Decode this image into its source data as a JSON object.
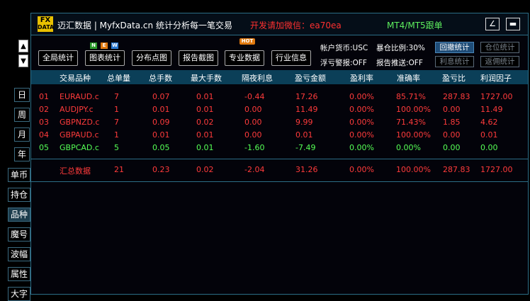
{
  "titlebar": {
    "logo_top": "FX",
    "logo_bottom": "DATA",
    "app_title": "迈汇数据 | MyfxData.cn   统计分析每一笔交易",
    "contact": "开发请加微信：ea70ea",
    "mt_label": "MT4/MT5跟单",
    "minimize_glyph": "∠",
    "restore_glyph": "▬"
  },
  "nav": {
    "up_glyph": "▲",
    "down_glyph": "▼"
  },
  "period_buttons": [
    "日",
    "周",
    "月",
    "年"
  ],
  "category_buttons": [
    "单币",
    "持仓",
    "品种",
    "魔号",
    "波幅",
    "属性",
    "大字"
  ],
  "active_category": "品种",
  "toolbar": {
    "buttons": [
      "全局统计",
      "图表统计",
      "分布点图",
      "报告截图",
      "专业数据",
      "行业信息"
    ],
    "badges": {
      "new": [
        "N",
        "E",
        "W"
      ],
      "hot": "HOT"
    }
  },
  "info": {
    "currency": "帐户货币:USC",
    "drawdown": "暴仓比例:30%",
    "float_alert": "浮亏警报:OFF",
    "report_push": "报告推送:OFF"
  },
  "mode_buttons": [
    {
      "label": "回撤统计",
      "active": true
    },
    {
      "label": "仓位统计",
      "active": false
    },
    {
      "label": "利息统计",
      "active": false
    },
    {
      "label": "返佣统计",
      "active": false
    }
  ],
  "table": {
    "headers": [
      "交易品种",
      "总单量",
      "总手数",
      "最大手数",
      "隔夜利息",
      "盈亏金额",
      "盈利率",
      "准确率",
      "盈亏比",
      "利润因子"
    ],
    "rows": [
      {
        "idx": "01",
        "symbol": "EURAUD.c",
        "orders": "7",
        "lots": "0.07",
        "max_lots": "0.01",
        "swap": "-0.44",
        "profit": "17.26",
        "profit_rate": "0.00%",
        "accuracy": "85.71%",
        "pl_ratio": "287.83",
        "profit_factor": "1727.00",
        "color": "red"
      },
      {
        "idx": "02",
        "symbol": "AUDJPY.c",
        "orders": "1",
        "lots": "0.01",
        "max_lots": "0.01",
        "swap": "0.00",
        "profit": "11.49",
        "profit_rate": "0.00%",
        "accuracy": "100.00%",
        "pl_ratio": "0.00",
        "profit_factor": "11.49",
        "color": "red"
      },
      {
        "idx": "03",
        "symbol": "GBPNZD.c",
        "orders": "7",
        "lots": "0.09",
        "max_lots": "0.02",
        "swap": "0.00",
        "profit": "9.99",
        "profit_rate": "0.00%",
        "accuracy": "71.43%",
        "pl_ratio": "1.85",
        "profit_factor": "4.62",
        "color": "red"
      },
      {
        "idx": "04",
        "symbol": "GBPAUD.c",
        "orders": "1",
        "lots": "0.01",
        "max_lots": "0.01",
        "swap": "0.00",
        "profit": "0.01",
        "profit_rate": "0.00%",
        "accuracy": "100.00%",
        "pl_ratio": "0.00",
        "profit_factor": "0.01",
        "color": "red"
      },
      {
        "idx": "05",
        "symbol": "GBPCAD.c",
        "orders": "5",
        "lots": "0.05",
        "max_lots": "0.01",
        "swap": "-1.60",
        "profit": "-7.49",
        "profit_rate": "0.00%",
        "accuracy": "0.00%",
        "pl_ratio": "0.00",
        "profit_factor": "0.00",
        "color": "green"
      }
    ],
    "summary": {
      "label": "汇总数据",
      "orders": "21",
      "lots": "0.23",
      "max_lots": "0.02",
      "swap": "-2.04",
      "profit": "31.26",
      "profit_rate": "0.00%",
      "accuracy": "100.00%",
      "pl_ratio": "287.83",
      "profit_factor": "1727.00"
    }
  },
  "colors": {
    "loss_red": "#ff3b3b",
    "gain_green": "#55ff55",
    "header_bg": "#0b3f58",
    "border": "#2b6d86"
  }
}
